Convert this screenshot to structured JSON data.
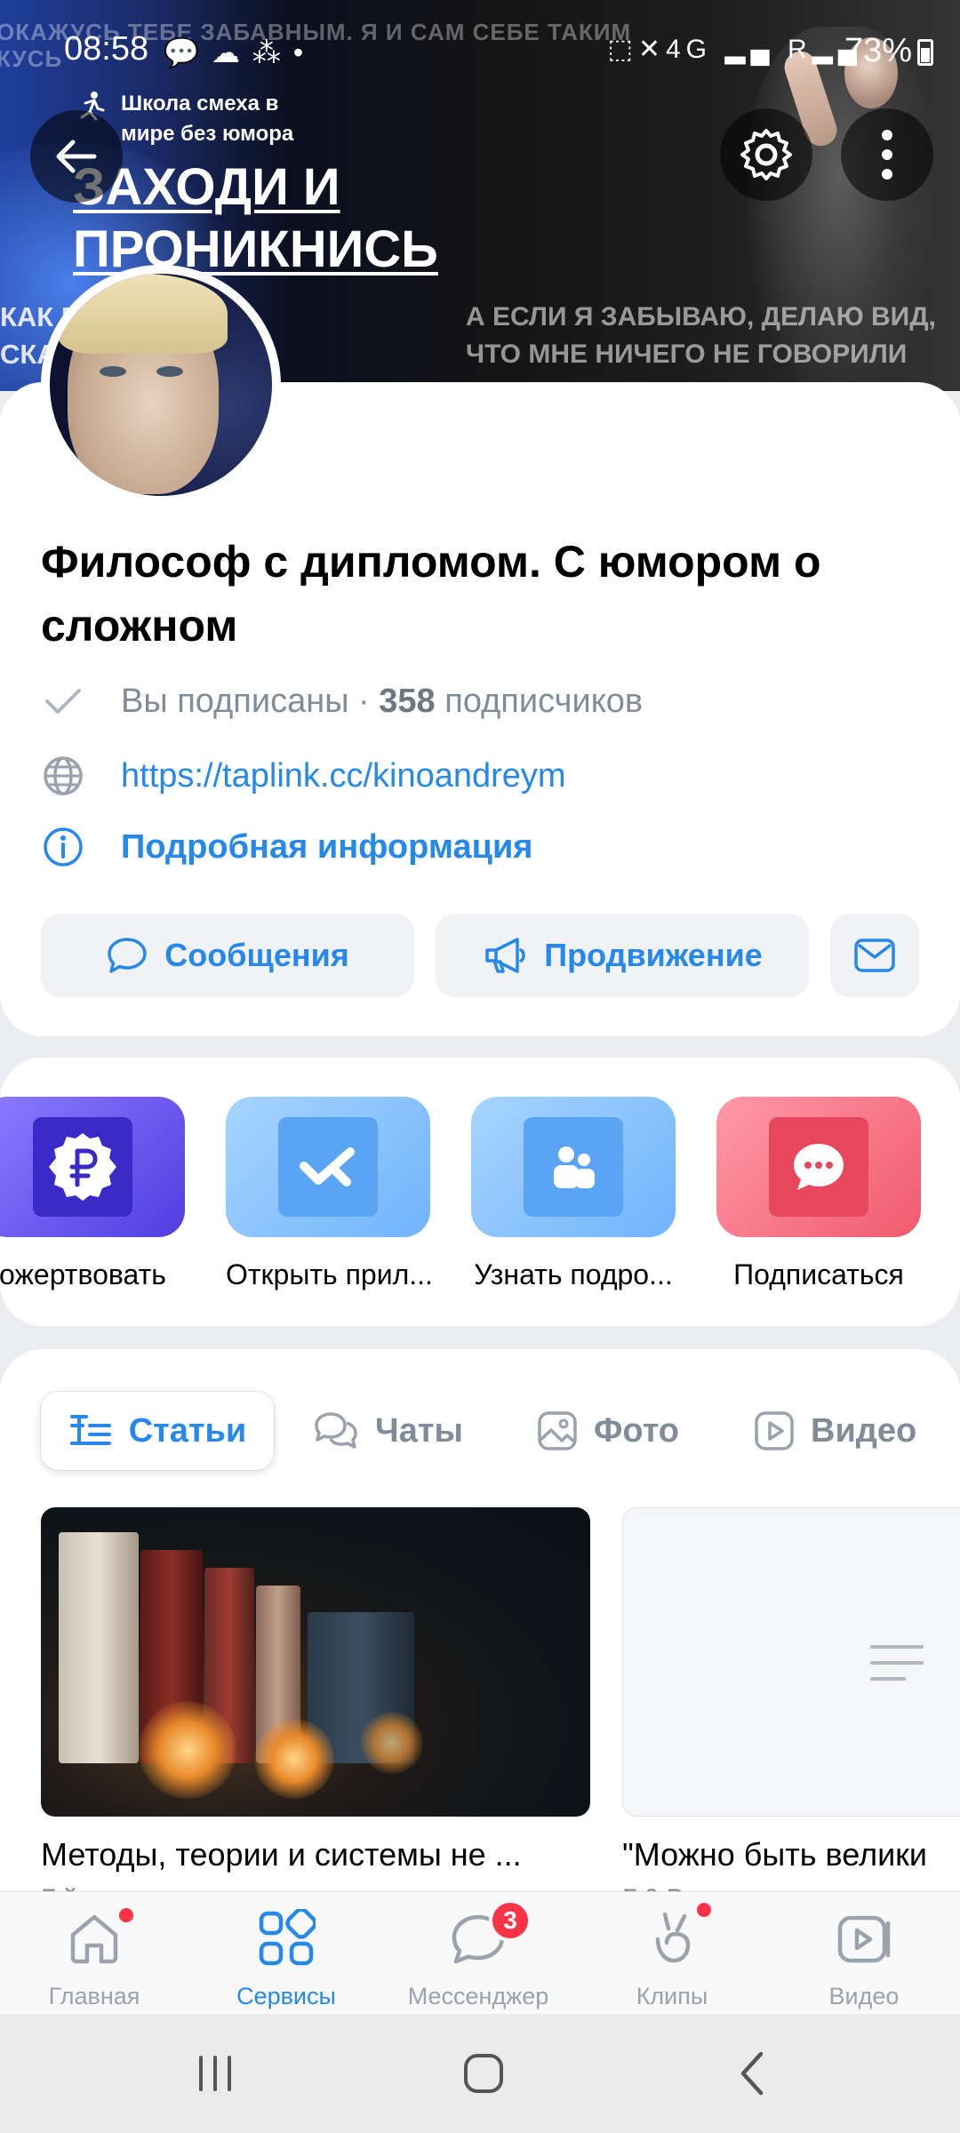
{
  "status_bar": {
    "time": "08:58",
    "battery": "73%",
    "left_icons": "💬☁⁂•",
    "right_icons": "⬚✕4G ▂▄ R▂▄"
  },
  "cover": {
    "top_text_1": "ОКАЖУСЬ ТЕБЕ ЗАБАВНЫМ. Я И САМ СЕБЕ ТАКИМ",
    "top_text_2": "КУСЬ",
    "school_line_1": "Школа смеха в",
    "school_line_2": "мире без юмора",
    "headline_1": "ЗАХОДИ И",
    "headline_2": "ПРОНИКНИСЬ",
    "left_caption_1": "КАК Б           НЕ ТОЖЕ",
    "left_caption_2": "СКА             ОВОРИТЬ",
    "right_caption_1": "А ЕСЛИ Я ЗАБЫВАЮ, ДЕЛАЮ ВИД,",
    "right_caption_2": "ЧТО МНЕ НИЧЕГО НЕ ГОВОРИЛИ"
  },
  "profile": {
    "title": "Философ с дипломом. С юмором о сложном",
    "subscribed": "Вы подписаны · ",
    "subscribers_count": "358",
    "subscribers_label": " подписчиков",
    "link": "https://taplink.cc/kinoandreym",
    "more_info": "Подробная информация"
  },
  "actions": {
    "messages": "Сообщения",
    "promotion": "Продвижение"
  },
  "apps": [
    {
      "label": "ожертвовать"
    },
    {
      "label": "Открыть прил..."
    },
    {
      "label": "Узнать подро..."
    },
    {
      "label": "Подписаться"
    }
  ],
  "tabs": {
    "articles": "Статьи",
    "chats": "Чаты",
    "photo": "Фото",
    "video": "Видео"
  },
  "articles": [
    {
      "title": "Методы, теории и системы не ...",
      "subtitle": "Г                              й"
    },
    {
      "title": "\"Можно быть велики",
      "subtitle": "Г                  0 В"
    }
  ],
  "bottom_nav": {
    "home": "Главная",
    "services": "Сервисы",
    "messenger": "Мессенджер",
    "messenger_badge": "3",
    "clips": "Клипы",
    "video": "Видео"
  },
  "colors": {
    "accent": "#2688eb",
    "secondary_text": "#818c99",
    "badge": "#ff3347"
  }
}
